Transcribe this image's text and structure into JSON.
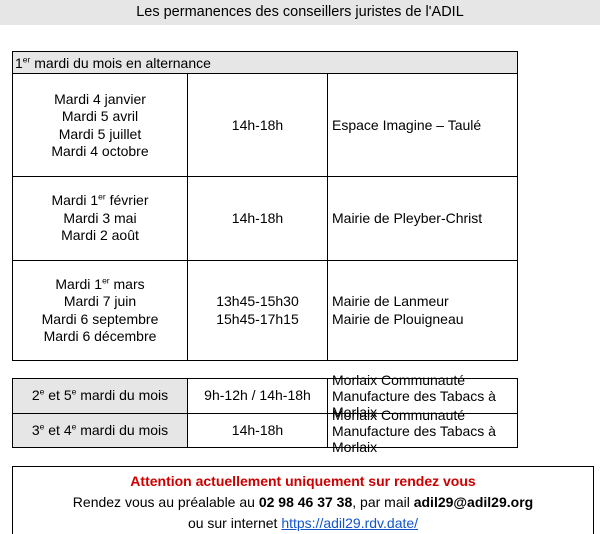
{
  "title": "Les permanences des conseillers juristes de l'ADIL",
  "section1": {
    "header_prefix": "1",
    "header_sup": "er",
    "header_rest": " mardi du mois en alternance",
    "rows": [
      {
        "dates": [
          {
            "pre": "Mardi 4 janvier"
          },
          {
            "pre": "Mardi 5 avril"
          },
          {
            "pre": "Mardi 5 juillet"
          },
          {
            "pre": "Mardi 4 octobre"
          }
        ],
        "hours": [
          "14h-18h"
        ],
        "places": [
          "Espace Imagine – Taulé"
        ]
      },
      {
        "dates": [
          {
            "pre": "Mardi 1",
            "sup": "er",
            "post": " février"
          },
          {
            "pre": "Mardi 3 mai"
          },
          {
            "pre": "Mardi 2 août"
          }
        ],
        "hours": [
          "14h-18h"
        ],
        "places": [
          "Mairie de Pleyber-Christ"
        ]
      },
      {
        "dates": [
          {
            "pre": "Mardi 1",
            "sup": "er",
            "post": " mars"
          },
          {
            "pre": "Mardi 7 juin"
          },
          {
            "pre": "Mardi 6 septembre"
          },
          {
            "pre": "Mardi 6 décembre"
          }
        ],
        "hours": [
          "13h45-15h30",
          "15h45-17h15"
        ],
        "places": [
          "Mairie de Lanmeur",
          "Mairie de Plouigneau"
        ]
      }
    ]
  },
  "section2": {
    "rows": [
      {
        "label": {
          "a": "2",
          "a_sup": "e",
          "b": " et 5",
          "b_sup": "e",
          "c": " mardi du mois"
        },
        "hours": "9h-12h / 14h-18h",
        "places": [
          "Morlaix Communauté",
          "Manufacture des Tabacs à Morlaix"
        ]
      },
      {
        "label": {
          "a": "3",
          "a_sup": "e",
          "b": " et 4",
          "b_sup": "e",
          "c": " mardi du mois"
        },
        "hours": "14h-18h",
        "places": [
          "Morlaix Communauté",
          "Manufacture des Tabacs à Morlaix"
        ]
      }
    ]
  },
  "notice": {
    "warning": "Attention actuellement uniquement sur rendez vous",
    "line2_pre": "Rendez vous au préalable au ",
    "phone": "02 98 46 37 38",
    "line2_mid": ", par mail ",
    "email": "adil29@adil29.org",
    "line3_pre": "ou sur internet ",
    "url": "https://adil29.rdv.date/"
  },
  "colors": {
    "header_grey": "#e6e6e6",
    "warning_red": "#cc0000",
    "link_blue": "#1155cc"
  }
}
